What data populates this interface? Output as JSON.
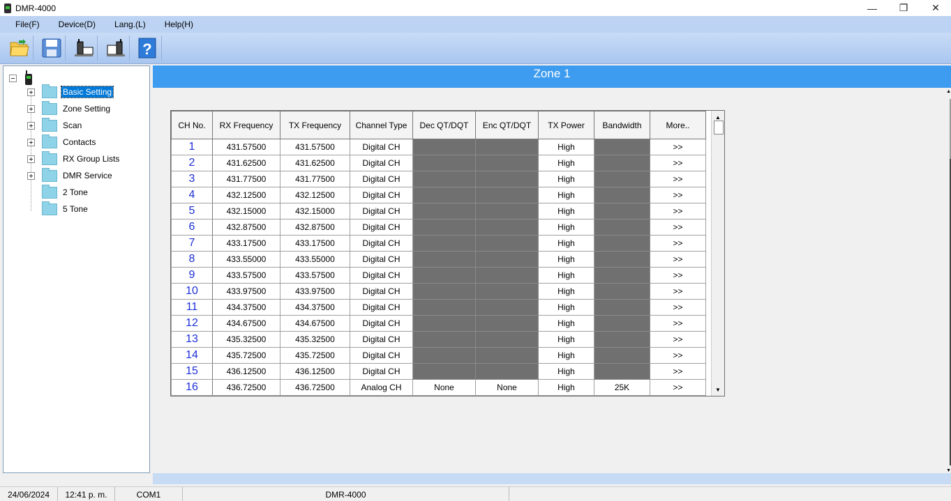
{
  "window": {
    "title": "DMR-4000",
    "minimize_glyph": "—",
    "restore_glyph": "❐",
    "close_glyph": "✕"
  },
  "menu": [
    "File(F)",
    "Device(D)",
    "Lang.(L)",
    "Help(H)"
  ],
  "toolbar": {
    "buttons": [
      "open-folder-icon",
      "save-disk-icon",
      "read-from-radio-icon",
      "write-to-radio-icon",
      "help-icon"
    ]
  },
  "tree": {
    "root_icon": "radio-icon",
    "items": [
      {
        "label": "Basic Setting",
        "expandable": true,
        "selected": true
      },
      {
        "label": "Zone Setting",
        "expandable": true,
        "selected": false
      },
      {
        "label": "Scan",
        "expandable": true,
        "selected": false
      },
      {
        "label": "Contacts",
        "expandable": true,
        "selected": false
      },
      {
        "label": "RX Group Lists",
        "expandable": true,
        "selected": false
      },
      {
        "label": "DMR Service",
        "expandable": true,
        "selected": false
      },
      {
        "label": "2 Tone",
        "expandable": false,
        "selected": false
      },
      {
        "label": "5 Tone",
        "expandable": false,
        "selected": false
      }
    ]
  },
  "main": {
    "zone_title": "Zone 1",
    "columns": [
      "CH No.",
      "RX Frequency",
      "TX Frequency",
      "Channel Type",
      "Dec QT/DQT",
      "Enc QT/DQT",
      "TX Power",
      "Bandwidth",
      "More.."
    ],
    "rows": [
      {
        "ch": "1",
        "rx": "431.57500",
        "tx": "431.57500",
        "type": "Digital CH",
        "dec": "",
        "enc": "",
        "power": "High",
        "bw": "",
        "more": ">>"
      },
      {
        "ch": "2",
        "rx": "431.62500",
        "tx": "431.62500",
        "type": "Digital CH",
        "dec": "",
        "enc": "",
        "power": "High",
        "bw": "",
        "more": ">>"
      },
      {
        "ch": "3",
        "rx": "431.77500",
        "tx": "431.77500",
        "type": "Digital CH",
        "dec": "",
        "enc": "",
        "power": "High",
        "bw": "",
        "more": ">>"
      },
      {
        "ch": "4",
        "rx": "432.12500",
        "tx": "432.12500",
        "type": "Digital CH",
        "dec": "",
        "enc": "",
        "power": "High",
        "bw": "",
        "more": ">>"
      },
      {
        "ch": "5",
        "rx": "432.15000",
        "tx": "432.15000",
        "type": "Digital CH",
        "dec": "",
        "enc": "",
        "power": "High",
        "bw": "",
        "more": ">>"
      },
      {
        "ch": "6",
        "rx": "432.87500",
        "tx": "432.87500",
        "type": "Digital CH",
        "dec": "",
        "enc": "",
        "power": "High",
        "bw": "",
        "more": ">>"
      },
      {
        "ch": "7",
        "rx": "433.17500",
        "tx": "433.17500",
        "type": "Digital CH",
        "dec": "",
        "enc": "",
        "power": "High",
        "bw": "",
        "more": ">>"
      },
      {
        "ch": "8",
        "rx": "433.55000",
        "tx": "433.55000",
        "type": "Digital CH",
        "dec": "",
        "enc": "",
        "power": "High",
        "bw": "",
        "more": ">>"
      },
      {
        "ch": "9",
        "rx": "433.57500",
        "tx": "433.57500",
        "type": "Digital CH",
        "dec": "",
        "enc": "",
        "power": "High",
        "bw": "",
        "more": ">>"
      },
      {
        "ch": "10",
        "rx": "433.97500",
        "tx": "433.97500",
        "type": "Digital CH",
        "dec": "",
        "enc": "",
        "power": "High",
        "bw": "",
        "more": ">>"
      },
      {
        "ch": "11",
        "rx": "434.37500",
        "tx": "434.37500",
        "type": "Digital CH",
        "dec": "",
        "enc": "",
        "power": "High",
        "bw": "",
        "more": ">>"
      },
      {
        "ch": "12",
        "rx": "434.67500",
        "tx": "434.67500",
        "type": "Digital CH",
        "dec": "",
        "enc": "",
        "power": "High",
        "bw": "",
        "more": ">>"
      },
      {
        "ch": "13",
        "rx": "435.32500",
        "tx": "435.32500",
        "type": "Digital CH",
        "dec": "",
        "enc": "",
        "power": "High",
        "bw": "",
        "more": ">>"
      },
      {
        "ch": "14",
        "rx": "435.72500",
        "tx": "435.72500",
        "type": "Digital CH",
        "dec": "",
        "enc": "",
        "power": "High",
        "bw": "",
        "more": ">>"
      },
      {
        "ch": "15",
        "rx": "436.12500",
        "tx": "436.12500",
        "type": "Digital CH",
        "dec": "",
        "enc": "",
        "power": "High",
        "bw": "",
        "more": ">>"
      },
      {
        "ch": "16",
        "rx": "436.72500",
        "tx": "436.72500",
        "type": "Analog CH",
        "dec": "None",
        "enc": "None",
        "power": "High",
        "bw": "25K",
        "more": ">>"
      }
    ]
  },
  "status": {
    "date": "24/06/2024",
    "time": "12:41 p. m.",
    "port": "COM1",
    "model": "DMR-4000"
  },
  "colors": {
    "zone_header": "#3d9bf0",
    "disabled_cell": "#707070",
    "channel_number": "#1c2fd6",
    "menubar": "#bcd3f3"
  }
}
